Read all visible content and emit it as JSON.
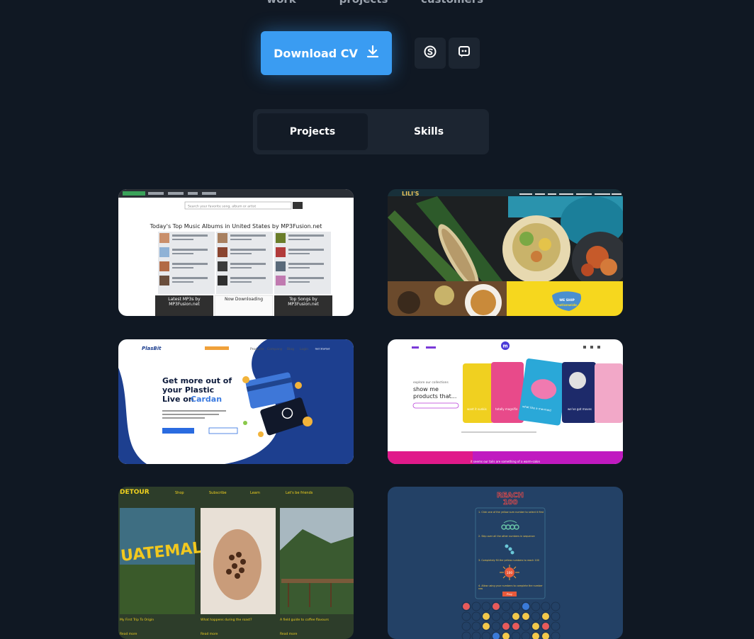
{
  "stats": [
    {
      "label": "work"
    },
    {
      "label": "projects"
    },
    {
      "label": "customers"
    }
  ],
  "actions": {
    "download_cv": "Download CV",
    "download_icon": "download-icon",
    "skype_icon": "skype-icon",
    "discord_icon": "discord-icon"
  },
  "tabs": [
    {
      "label": "Projects",
      "active": true
    },
    {
      "label": "Skills",
      "active": false
    }
  ],
  "colors": {
    "background": "#101823",
    "accent": "#3a9cf2",
    "panel": "#1c2531"
  },
  "projects": {
    "mp3": {
      "heading": "Today's Top Music Albums in United States by MP3Fusion.net",
      "search_placeholder": "Search your favorite song, album or artist",
      "box1": "Latest MP3s by MP3Fusion.net",
      "box2": "Now Downloading",
      "box3": "Top Songs by MP3Fusion.net"
    },
    "food": {
      "brand": "LILI'S",
      "badge_line1": "WE SHIP",
      "badge_line2": "nationwide"
    },
    "plasbit": {
      "logo": "PlasBit",
      "headline1": "Get more out of",
      "headline2": "your Plastic",
      "headline3": "Live on",
      "headline4": "Cardan",
      "nav": [
        "Products",
        "Company",
        "Blog",
        "Login"
      ],
      "cta": "Get Started"
    },
    "shop": {
      "intro": "explore our collections",
      "headline1": "show me",
      "headline2": "products that...",
      "footer": "it seems our tails are something of a warm-salon",
      "cards": [
        "want it sunkis",
        "totally magnifie",
        "what like a mermaid",
        "we've got moves"
      ]
    },
    "detour": {
      "logo": "DETOUR",
      "nav": [
        "Shop",
        "Subscribe",
        "Learn",
        "Let's be friends"
      ],
      "postcard": "UATEMAL",
      "captions": [
        "My First Trip To Origin",
        "What happens during the roast?",
        "A field guide to coffee flavours"
      ],
      "read_more": "Read more"
    },
    "reach": {
      "title1": "REACH",
      "title2": "100",
      "steps": [
        "1. Click one of the yellow sum number to select it first",
        "2. Skip over all the other numbers in sequence",
        "3. Completely fill the yellow numbers to reach 100",
        "4. Allow using your numbers to complete the number row"
      ],
      "center": "100",
      "btn": "Play"
    }
  }
}
